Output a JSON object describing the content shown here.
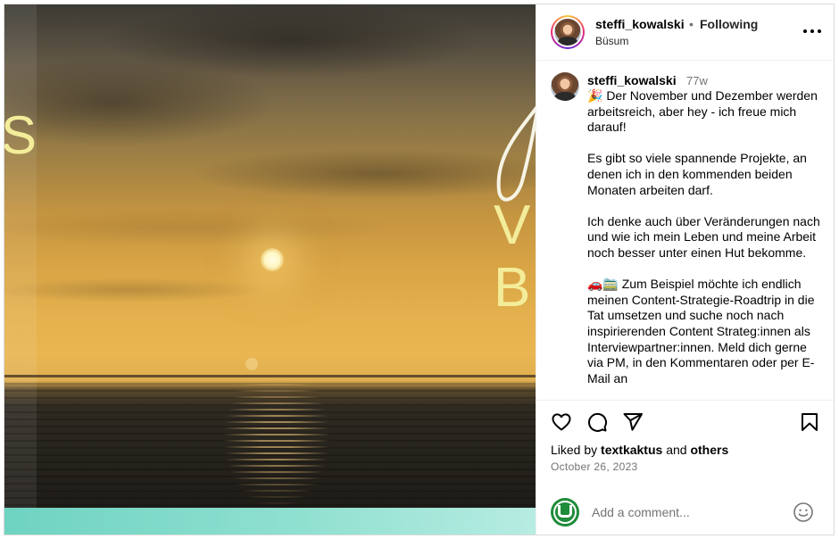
{
  "media": {
    "overlay_texts": {
      "s": "S",
      "v": "V",
      "b": "B"
    }
  },
  "post": {
    "username": "steffi_kowalski",
    "follow_status": "Following",
    "separator": "•",
    "location": "Büsum",
    "more_icon": "more-horizontal-icon"
  },
  "caption": {
    "username": "steffi_kowalski",
    "time_ago": "77w",
    "paragraphs": [
      "🎉 Der November und Dezember werden arbeitsreich, aber hey - ich freue mich darauf!",
      "Es gibt so viele spannende Projekte, an denen ich in den kommenden beiden Monaten arbeiten darf.",
      "Ich denke auch über Veränderungen nach und wie ich mein Leben und meine Arbeit noch besser unter einen Hut bekomme.",
      "🚗🚞 Zum Beispiel möchte ich endlich meinen Content-Strategie-Roadtrip in die Tat umsetzen und suche noch nach inspirierenden Content Strateg:innen als Interviewpartner:innen. Meld dich gerne via PM, in den Kommentaren oder per E-Mail an"
    ]
  },
  "actions": {
    "like_icon": "heart-icon",
    "comment_icon": "comment-icon",
    "share_icon": "share-icon",
    "save_icon": "bookmark-icon"
  },
  "likes": {
    "prefix": "Liked by",
    "user": "textkaktus",
    "connector": "and",
    "others": "others"
  },
  "date": "October 26, 2023",
  "comment_box": {
    "placeholder": "Add a comment...",
    "emoji_icon": "smiley-icon"
  }
}
